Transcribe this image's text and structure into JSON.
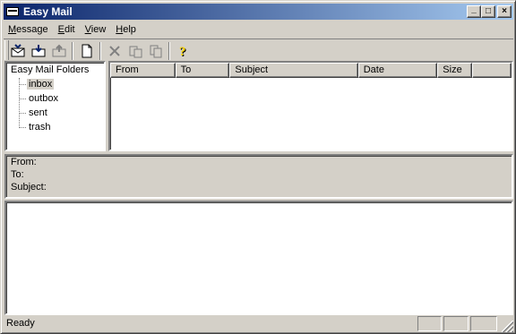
{
  "window": {
    "title": "Easy Mail"
  },
  "title_buttons": {
    "minimize": "_",
    "maximize": "□",
    "close": "×"
  },
  "menu": [
    {
      "label": "Message",
      "accel": "M",
      "rest": "essage"
    },
    {
      "label": "Edit",
      "accel": "E",
      "rest": "dit"
    },
    {
      "label": "View",
      "accel": "V",
      "rest": "iew"
    },
    {
      "label": "Help",
      "accel": "H",
      "rest": "elp"
    }
  ],
  "toolbar": [
    {
      "icon": "send-receive-icon",
      "enabled": true
    },
    {
      "icon": "receive-icon",
      "enabled": true
    },
    {
      "icon": "send-icon",
      "enabled": false
    },
    {
      "icon": "new-message-icon",
      "enabled": true
    },
    {
      "icon": "delete-icon",
      "enabled": false
    },
    {
      "icon": "move-icon",
      "enabled": false
    },
    {
      "icon": "copy-icon",
      "enabled": false
    },
    {
      "icon": "help-icon",
      "enabled": true
    }
  ],
  "folders": {
    "root": "Easy Mail Folders",
    "items": [
      "inbox",
      "outbox",
      "sent",
      "trash"
    ],
    "selected": "inbox"
  },
  "message_list": {
    "columns": [
      "From",
      "To",
      "Subject",
      "Date",
      "Size"
    ]
  },
  "header_pane": {
    "from_label": "From:",
    "to_label": "To:",
    "subject_label": "Subject:"
  },
  "status": {
    "text": "Ready"
  }
}
